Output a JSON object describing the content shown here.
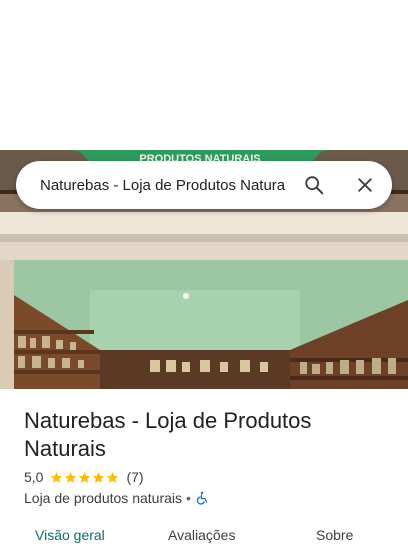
{
  "search": {
    "value": "Naturebas - Loja de Produtos Naturais"
  },
  "photo": {
    "sign_text": "PRODUTOS NATURAIS"
  },
  "place": {
    "name": "Naturebas - Loja de Produtos Naturais",
    "rating": "5,0",
    "stars": 5,
    "review_count": "(7)",
    "category": "Loja de produtos naturais",
    "separator": "•"
  },
  "tabs": [
    {
      "label": "Visão geral"
    },
    {
      "label": "Avaliações"
    },
    {
      "label": "Sobre"
    }
  ],
  "colors": {
    "star": "#fbbc04",
    "active_tab": "#0b6e6f",
    "accessibility": "#1a73e8"
  },
  "icons": [
    "search-icon",
    "close-icon",
    "star-icon",
    "wheelchair-icon"
  ]
}
